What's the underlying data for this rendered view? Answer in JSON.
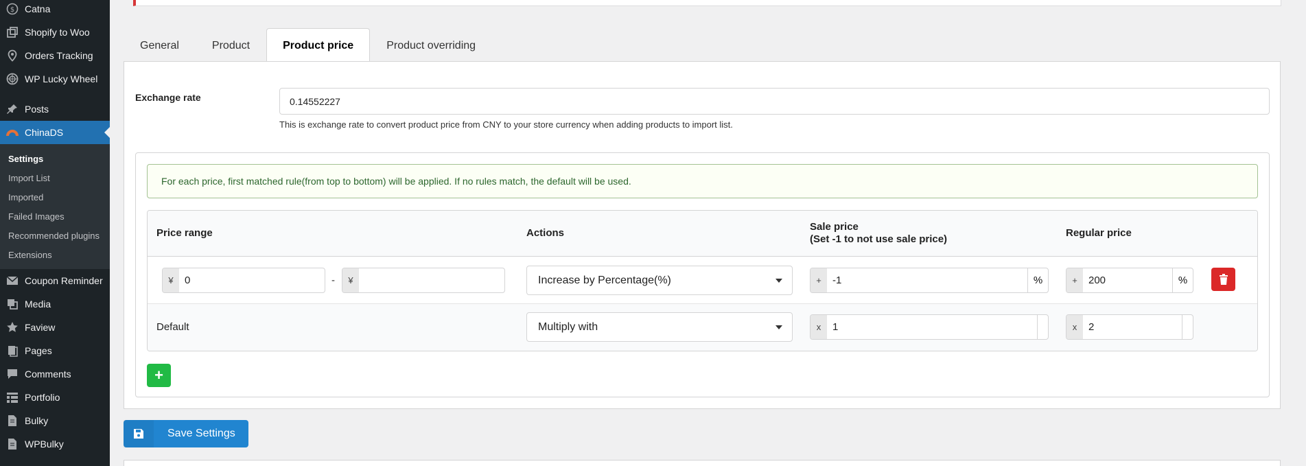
{
  "sidebar": {
    "top_items": [
      {
        "label": "Catna",
        "icon": "dollar-icon"
      },
      {
        "label": "Shopify to Woo",
        "icon": "external-icon"
      },
      {
        "label": "Orders Tracking",
        "icon": "location-pin-icon"
      },
      {
        "label": "WP Lucky Wheel",
        "icon": "wheel-icon"
      }
    ],
    "posts": {
      "label": "Posts",
      "icon": "pin-icon"
    },
    "active": {
      "label": "ChinaDS",
      "icon": "chinads-icon"
    },
    "submenu": [
      "Settings",
      "Import List",
      "Imported",
      "Failed Images",
      "Recommended plugins",
      "Extensions"
    ],
    "bottom_items": [
      {
        "label": "Coupon Reminder",
        "icon": "mail-icon"
      },
      {
        "label": "Media",
        "icon": "media-icon"
      },
      {
        "label": "Faview",
        "icon": "star-icon"
      },
      {
        "label": "Pages",
        "icon": "page-icon"
      },
      {
        "label": "Comments",
        "icon": "comment-icon"
      },
      {
        "label": "Portfolio",
        "icon": "portfolio-icon"
      },
      {
        "label": "Bulky",
        "icon": "doc-icon"
      },
      {
        "label": "WPBulky",
        "icon": "doc-icon"
      }
    ]
  },
  "tabs": [
    "General",
    "Product",
    "Product price",
    "Product overriding"
  ],
  "active_tab": "Product price",
  "exchange": {
    "label": "Exchange rate",
    "value": "0.14552227",
    "help": "This is exchange rate to convert product price from CNY to your store currency when adding products to import list."
  },
  "rules": {
    "info": "For each price, first matched rule(from top to bottom) will be applied. If no rules match, the default will be used.",
    "headers": {
      "price_range": "Price range",
      "actions": "Actions",
      "sale_price_line1": "Sale price",
      "sale_price_line2": "(Set -1 to not use sale price)",
      "regular_price": "Regular price"
    },
    "row": {
      "currency": "¥",
      "from": "0",
      "to": "",
      "dash": "-",
      "action": "Increase by Percentage(%)",
      "sale_prefix": "+",
      "sale_value": "-1",
      "sale_suffix": "%",
      "regular_prefix": "+",
      "regular_value": "200",
      "regular_suffix": "%"
    },
    "default_row": {
      "label": "Default",
      "action": "Multiply with",
      "sale_prefix": "x",
      "sale_value": "1",
      "regular_prefix": "x",
      "regular_value": "2"
    },
    "add_label": "+"
  },
  "save_label": "Save Settings",
  "colors": {
    "primary": "#2185d0",
    "danger": "#db2828",
    "success": "#21ba45",
    "wp_blue": "#2271b1"
  }
}
